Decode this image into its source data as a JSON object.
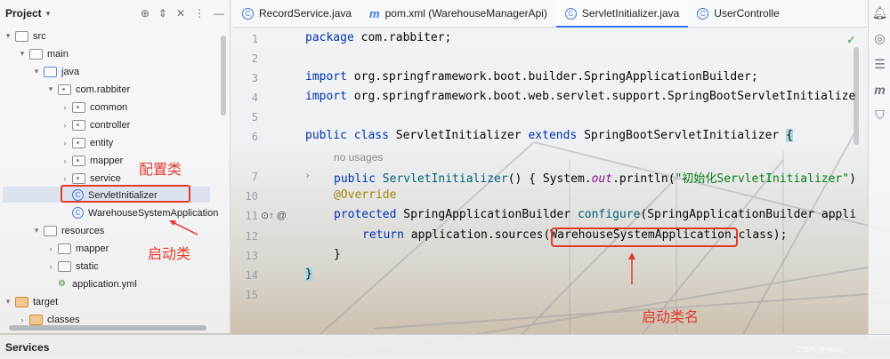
{
  "project": {
    "title": "Project",
    "tree": [
      {
        "label": "src",
        "icon": "folder-icon",
        "indent": 0,
        "arrow": "▾"
      },
      {
        "label": "main",
        "icon": "folder-icon",
        "indent": 1,
        "arrow": "▾"
      },
      {
        "label": "java",
        "icon": "folder-blue-icon",
        "indent": 2,
        "arrow": "▾"
      },
      {
        "label": "com.rabbiter",
        "icon": "package-icon",
        "indent": 3,
        "arrow": "▾"
      },
      {
        "label": "common",
        "icon": "package-icon",
        "indent": 4,
        "arrow": "›"
      },
      {
        "label": "controller",
        "icon": "package-icon",
        "indent": 4,
        "arrow": "›"
      },
      {
        "label": "entity",
        "icon": "package-icon",
        "indent": 4,
        "arrow": "›"
      },
      {
        "label": "mapper",
        "icon": "package-icon",
        "indent": 4,
        "arrow": "›"
      },
      {
        "label": "service",
        "icon": "package-icon",
        "indent": 4,
        "arrow": "›"
      },
      {
        "label": "ServletInitializer",
        "icon": "class-icon",
        "indent": 4,
        "arrow": ""
      },
      {
        "label": "WarehouseSystemApplication",
        "icon": "class-icon",
        "indent": 4,
        "arrow": ""
      },
      {
        "label": "resources",
        "icon": "folder-icon",
        "indent": 2,
        "arrow": "▾"
      },
      {
        "label": "mapper",
        "icon": "folder-icon",
        "indent": 3,
        "arrow": "›"
      },
      {
        "label": "static",
        "icon": "folder-icon",
        "indent": 3,
        "arrow": "›"
      },
      {
        "label": "application.yml",
        "icon": "yml-icon",
        "indent": 3,
        "arrow": ""
      },
      {
        "label": "target",
        "icon": "folder-orange-icon",
        "indent": 0,
        "arrow": "▾"
      },
      {
        "label": "classes",
        "icon": "folder-orange-icon",
        "indent": 1,
        "arrow": "›"
      }
    ]
  },
  "annotations": {
    "config_class": "配置类",
    "startup_class": "启动类",
    "startup_class_name": "启动类名"
  },
  "tabs": [
    {
      "label": "RecordService.java",
      "icon": "class-icon"
    },
    {
      "label": "pom.xml (WarehouseManagerApi)",
      "icon": "maven-icon"
    },
    {
      "label": "ServletInitializer.java",
      "icon": "class-icon",
      "active": true
    },
    {
      "label": "UserControlle",
      "icon": "class-icon"
    }
  ],
  "editor": {
    "line_numbers": [
      "1",
      "2",
      "3",
      "4",
      "5",
      "6",
      "7",
      "10",
      "11",
      "12",
      "13",
      "14",
      "15"
    ],
    "hint_no_usages": "no usages",
    "lines": {
      "l1_kw": "package",
      "l1_rest": " com.rabbiter;",
      "l3_kw": "import",
      "l3_rest": " org.springframework.boot.builder.SpringApplicationBuilder;",
      "l4_kw": "import",
      "l4_rest": " org.springframework.boot.web.servlet.support.SpringBootServletInitialize",
      "l6_kw1": "public class",
      "l6_name": " ServletInitializer ",
      "l6_kw2": "extends",
      "l6_rest": " SpringBootServletInitializer ",
      "l6_brace": "{",
      "l7_kw": "public",
      "l7_fn": " ServletInitializer",
      "l7_a": "() { System.",
      "l7_out": "out",
      "l7_b": ".println(",
      "l7_str": "\"初始化ServletInitializer\"",
      "l7_c": ")",
      "l10_an": "@Override",
      "l11_kw": "protected",
      "l11_a": " SpringApplicationBuilder ",
      "l11_fn": "configure",
      "l11_b": "(SpringApplicationBuilder appli",
      "l12_kw": "return",
      "l12_a": " application.sources(",
      "l12_cls": "WarehouseSystemApplication",
      "l12_b": ".class);",
      "l13": "}",
      "l14": "}"
    }
  },
  "services": {
    "title": "Services"
  },
  "watermark": "CSDN @yixing_"
}
